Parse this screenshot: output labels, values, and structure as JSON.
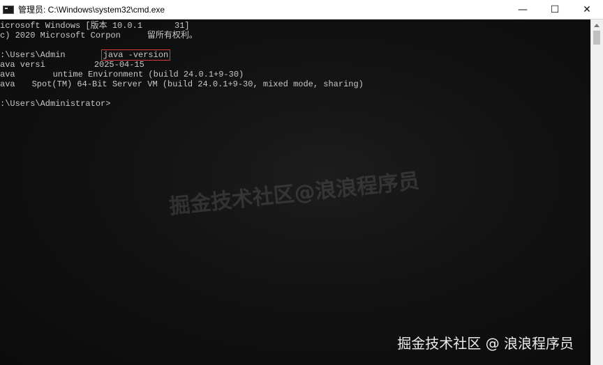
{
  "window": {
    "title": "管理员: C:\\Windows\\system32\\cmd.exe",
    "minimize_glyph": "—",
    "maximize_glyph": "☐",
    "close_glyph": "✕"
  },
  "console": {
    "lines": [
      "icrosoft Windows [版本 10.0.1",
      "c) 2020 Microsoft Corpon",
      "",
      ":\\Users\\Admin",
      "ava versi",
      "ava",
      "ava",
      "",
      ":\\Users\\Administrator>"
    ],
    "line1_tail": "31]",
    "line2_tail": "留所有权利。",
    "line4_cmd": "java -version",
    "line5_tail": "2025-04-15",
    "line6_tail": "untime Environment (build 24.0.1+9-30)",
    "line7_tail": "Spot(TM) 64-Bit Server VM (build 24.0.1+9-30, mixed mode, sharing)"
  },
  "watermark": {
    "center": "掘金技术社区@浪浪程序员",
    "corner": "掘金技术社区 @ 浪浪程序员"
  },
  "icons": {
    "app": "cmd-icon",
    "minimize": "minimize-icon",
    "maximize": "maximize-icon",
    "close": "close-icon"
  }
}
